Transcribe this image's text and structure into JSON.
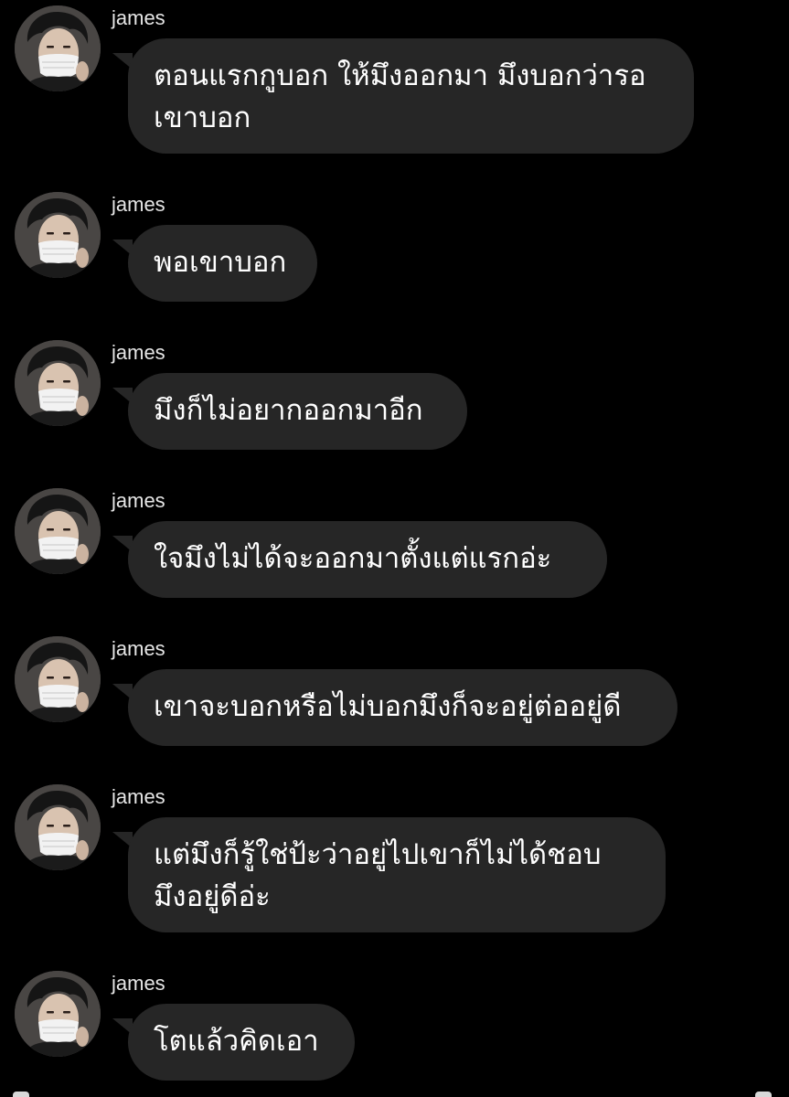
{
  "conversation": {
    "messages": [
      {
        "sender": "james",
        "avatar_icon": "profile-photo-masked",
        "text": "ตอนแรกกูบอก ให้มึงออกมา มึงบอกว่ารอ\nเขาบอก"
      },
      {
        "sender": "james",
        "avatar_icon": "profile-photo-masked",
        "text": "พอเขาบอก"
      },
      {
        "sender": "james",
        "avatar_icon": "profile-photo-masked",
        "text": "มึงก็ไม่อยากออกมาอีก"
      },
      {
        "sender": "james",
        "avatar_icon": "profile-photo-masked",
        "text": "ใจมึงไม่ได้จะออกมาตั้งแต่แรกอ่ะ"
      },
      {
        "sender": "james",
        "avatar_icon": "profile-photo-masked",
        "text": "เขาจะบอกหรือไม่บอกมึงก็จะอยู่ต่ออยู่ดี"
      },
      {
        "sender": "james",
        "avatar_icon": "profile-photo-masked",
        "text": "แต่มึงก็รู้ใช่ป้ะว่าอยู่ไปเขาก็ไม่ได้ชอบ\nมึงอยู่ดีอ่ะ"
      },
      {
        "sender": "james",
        "avatar_icon": "profile-photo-masked",
        "text": "โตแล้วคิดเอา"
      }
    ]
  },
  "colors": {
    "background": "#000000",
    "bubble": "#262626",
    "bubble_text": "#ffffff",
    "sender_text": "#e6e6e6"
  }
}
